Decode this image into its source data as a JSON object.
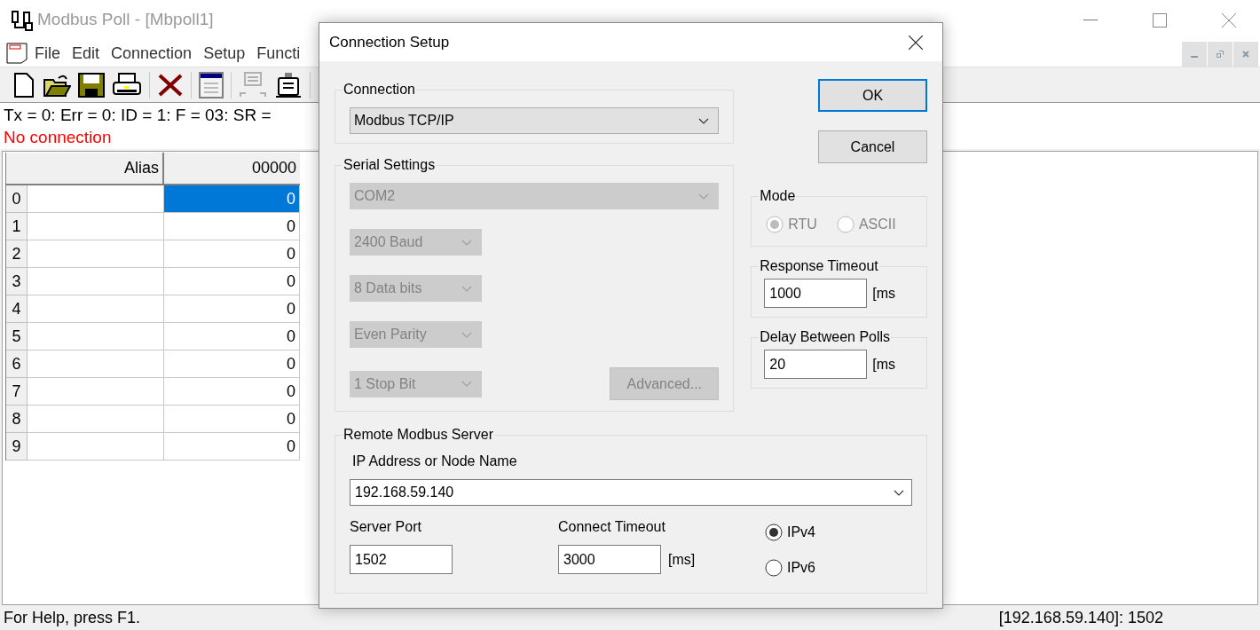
{
  "window": {
    "title": "Modbus Poll - [Mbpoll1]"
  },
  "menu": [
    "File",
    "Edit",
    "Connection",
    "Setup",
    "Functi"
  ],
  "status_lines": [
    {
      "text": "Tx = 0: Err = 0: ID = 1: F = 03: SR =",
      "kind": "info"
    },
    {
      "text": "No connection",
      "kind": "error"
    }
  ],
  "grid": {
    "columns": [
      "Alias",
      "00000"
    ],
    "rows": [
      {
        "header": "0",
        "value": "0",
        "selected": true
      },
      {
        "header": "1",
        "value": "0",
        "selected": false
      },
      {
        "header": "2",
        "value": "0",
        "selected": false
      },
      {
        "header": "3",
        "value": "0",
        "selected": false
      },
      {
        "header": "4",
        "value": "0",
        "selected": false
      },
      {
        "header": "5",
        "value": "0",
        "selected": false
      },
      {
        "header": "6",
        "value": "0",
        "selected": false
      },
      {
        "header": "7",
        "value": "0",
        "selected": false
      },
      {
        "header": "8",
        "value": "0",
        "selected": false
      },
      {
        "header": "9",
        "value": "0",
        "selected": false
      }
    ]
  },
  "status_bar": {
    "help": "For Help, press F1.",
    "address": "[192.168.59.140]: 1502"
  },
  "dialog": {
    "title": "Connection Setup",
    "connection": {
      "label": "Connection",
      "value": "Modbus TCP/IP"
    },
    "serial": {
      "label": "Serial Settings",
      "disabled": true,
      "port": "COM2",
      "options": [
        "2400 Baud",
        "8 Data bits",
        "Even Parity",
        "1 Stop Bit"
      ],
      "advanced": "Advanced..."
    },
    "buttons": [
      {
        "label": "OK",
        "default": true
      },
      {
        "label": "Cancel",
        "default": false
      }
    ],
    "mode": {
      "label": "Mode",
      "disabled": true,
      "options": [
        {
          "label": "RTU",
          "selected": true
        },
        {
          "label": "ASCII",
          "selected": false
        }
      ]
    },
    "timeouts": [
      {
        "label": "Response Timeout",
        "value": "1000",
        "unit": "[ms"
      },
      {
        "label": "Delay Between Polls",
        "value": "20",
        "unit": "[ms"
      }
    ],
    "remote": {
      "label": "Remote Modbus Server",
      "ip_label": "IP Address or Node Name",
      "ip_value": "192.168.59.140",
      "port_label": "Server Port",
      "port_value": "1502",
      "timeout_label": "Connect Timeout",
      "timeout_value": "3000",
      "unit": "[ms]",
      "ip_versions": [
        {
          "label": "IPv4",
          "selected": true
        },
        {
          "label": "IPv6",
          "selected": false
        }
      ]
    }
  }
}
